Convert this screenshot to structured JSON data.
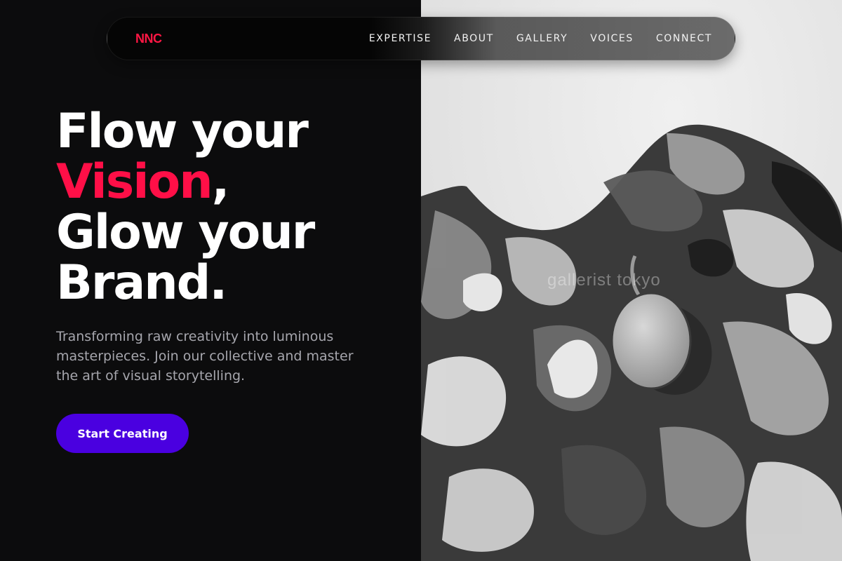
{
  "nav": {
    "logo": "NNC",
    "links": [
      "EXPERTISE",
      "ABOUT",
      "GALLERY",
      "VOICES",
      "CONNECT"
    ]
  },
  "hero": {
    "headline_line1": "Flow your",
    "headline_accent": "Vision",
    "headline_comma": ",",
    "headline_line3": "Glow your",
    "headline_line4": "Brand.",
    "subtext": "Transforming raw creativity into luminous masterpieces. Join our collective and master the art of visual storytelling.",
    "cta_label": "Start Creating"
  },
  "image": {
    "description_icon": "paint-palette-image",
    "watermark": "gallerist tokyo"
  },
  "colors": {
    "background": "#0c0c0d",
    "accent_red": "#ff0f47",
    "cta_purple": "#4a00e0",
    "subtext_gray": "#a6a6ad"
  }
}
